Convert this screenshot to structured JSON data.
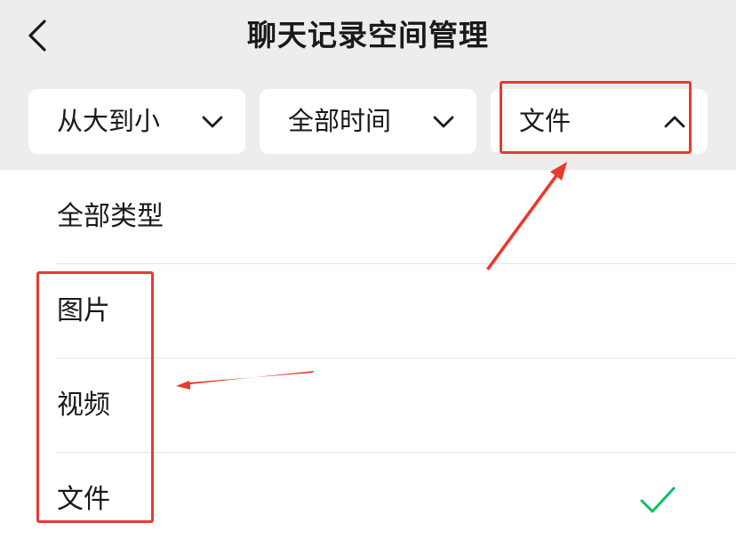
{
  "header": {
    "title": "聊天记录空间管理",
    "back_icon": "chevron-left-icon"
  },
  "filters": {
    "sort": {
      "label": "从大到小",
      "icon": "chevron-down-icon"
    },
    "time": {
      "label": "全部时间",
      "icon": "chevron-down-icon"
    },
    "type": {
      "label": "文件",
      "icon": "chevron-up-icon",
      "expanded": true
    }
  },
  "type_menu": {
    "items": [
      {
        "label": "全部类型",
        "selected": false
      },
      {
        "label": "图片",
        "selected": false
      },
      {
        "label": "视频",
        "selected": false
      },
      {
        "label": "文件",
        "selected": true
      }
    ],
    "selected_icon": "checkmark-icon"
  },
  "colors": {
    "header_bg": "#ededed",
    "text": "#191919",
    "check": "#07c160",
    "annotation": "#e83a30"
  }
}
